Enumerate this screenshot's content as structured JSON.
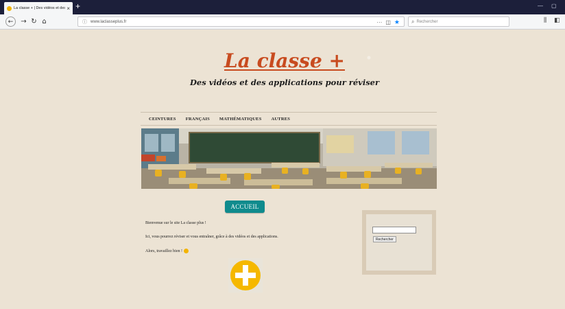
{
  "browser": {
    "tab_title": "La classe + | Des vidéos et des a",
    "tab_close": "×",
    "new_tab": "+",
    "url": "www.laclasseplus.fr",
    "url_more": "···",
    "search_placeholder": "Rechercher",
    "window_minimize": "—",
    "window_maximize": "▢"
  },
  "site": {
    "title": "La classe +",
    "tagline": "Des vidéos et des applications pour réviser",
    "menu": [
      "CEINTURES",
      "FRANÇAIS",
      "MATHÉMATIQUES",
      "AUTRES"
    ],
    "section_button": "ACCUEIL",
    "paragraphs": [
      "Bienvenue sur le site La classe plus !",
      "Ici, vous pourrez réviser et vous entraîner, grâce à des vidéos et des applications.",
      "Alors, travaillez bien !"
    ],
    "search_button": "Rechercher"
  },
  "colors": {
    "accent_red": "#c84b1f",
    "button_teal": "#0f8b8d",
    "plus_yellow": "#f5b800",
    "page_bg": "#ece3d4",
    "browser_dark": "#1c1f3a"
  }
}
